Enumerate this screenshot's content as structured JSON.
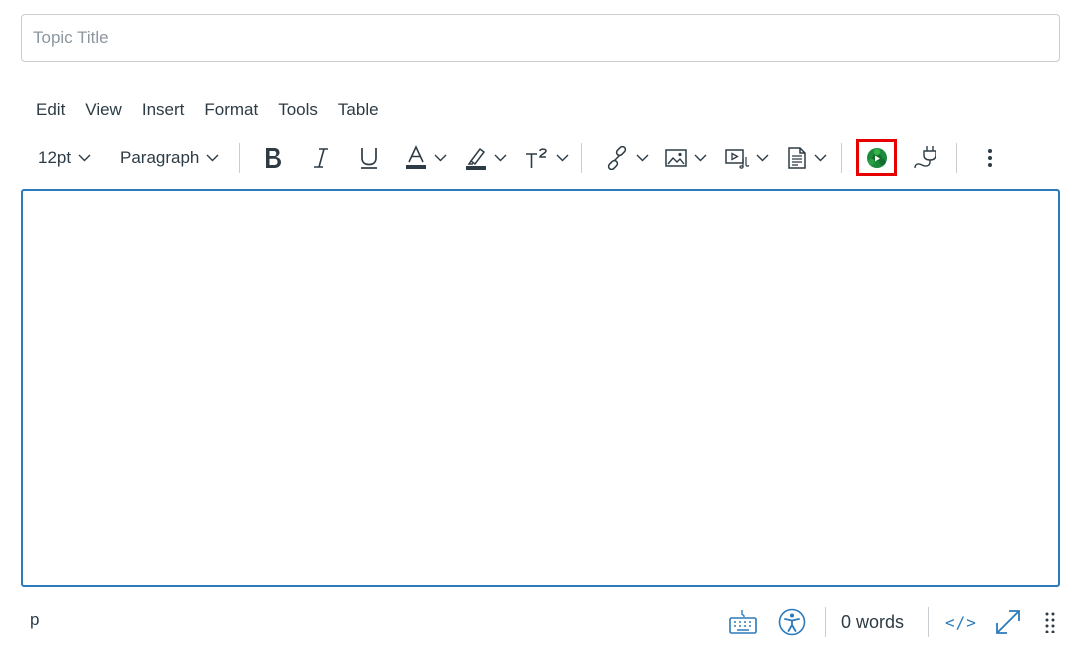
{
  "topic_title": {
    "placeholder": "Topic Title",
    "value": ""
  },
  "menubar": [
    "Edit",
    "View",
    "Insert",
    "Format",
    "Tools",
    "Table"
  ],
  "toolbar": {
    "font_size": "12pt",
    "block_format": "Paragraph",
    "icons": {
      "bold": "bold-icon",
      "italic": "italic-icon",
      "underline": "underline-icon",
      "text_color": "text-color-icon",
      "highlight": "highlight-color-icon",
      "superscript": "superscript-icon",
      "link": "link-icon",
      "image": "image-icon",
      "media": "media-icon",
      "document": "document-icon",
      "external_tool": "studio-logo-icon",
      "plugin": "plug-icon",
      "more": "more-vertical-icon"
    }
  },
  "statusbar": {
    "path": "p",
    "word_count": "0 words",
    "html_toggle": "</>"
  },
  "colors": {
    "text": "#2d3b45",
    "accent_blue": "#2b7abc",
    "highlight_red": "#e60000",
    "border": "#c7cdd1"
  }
}
